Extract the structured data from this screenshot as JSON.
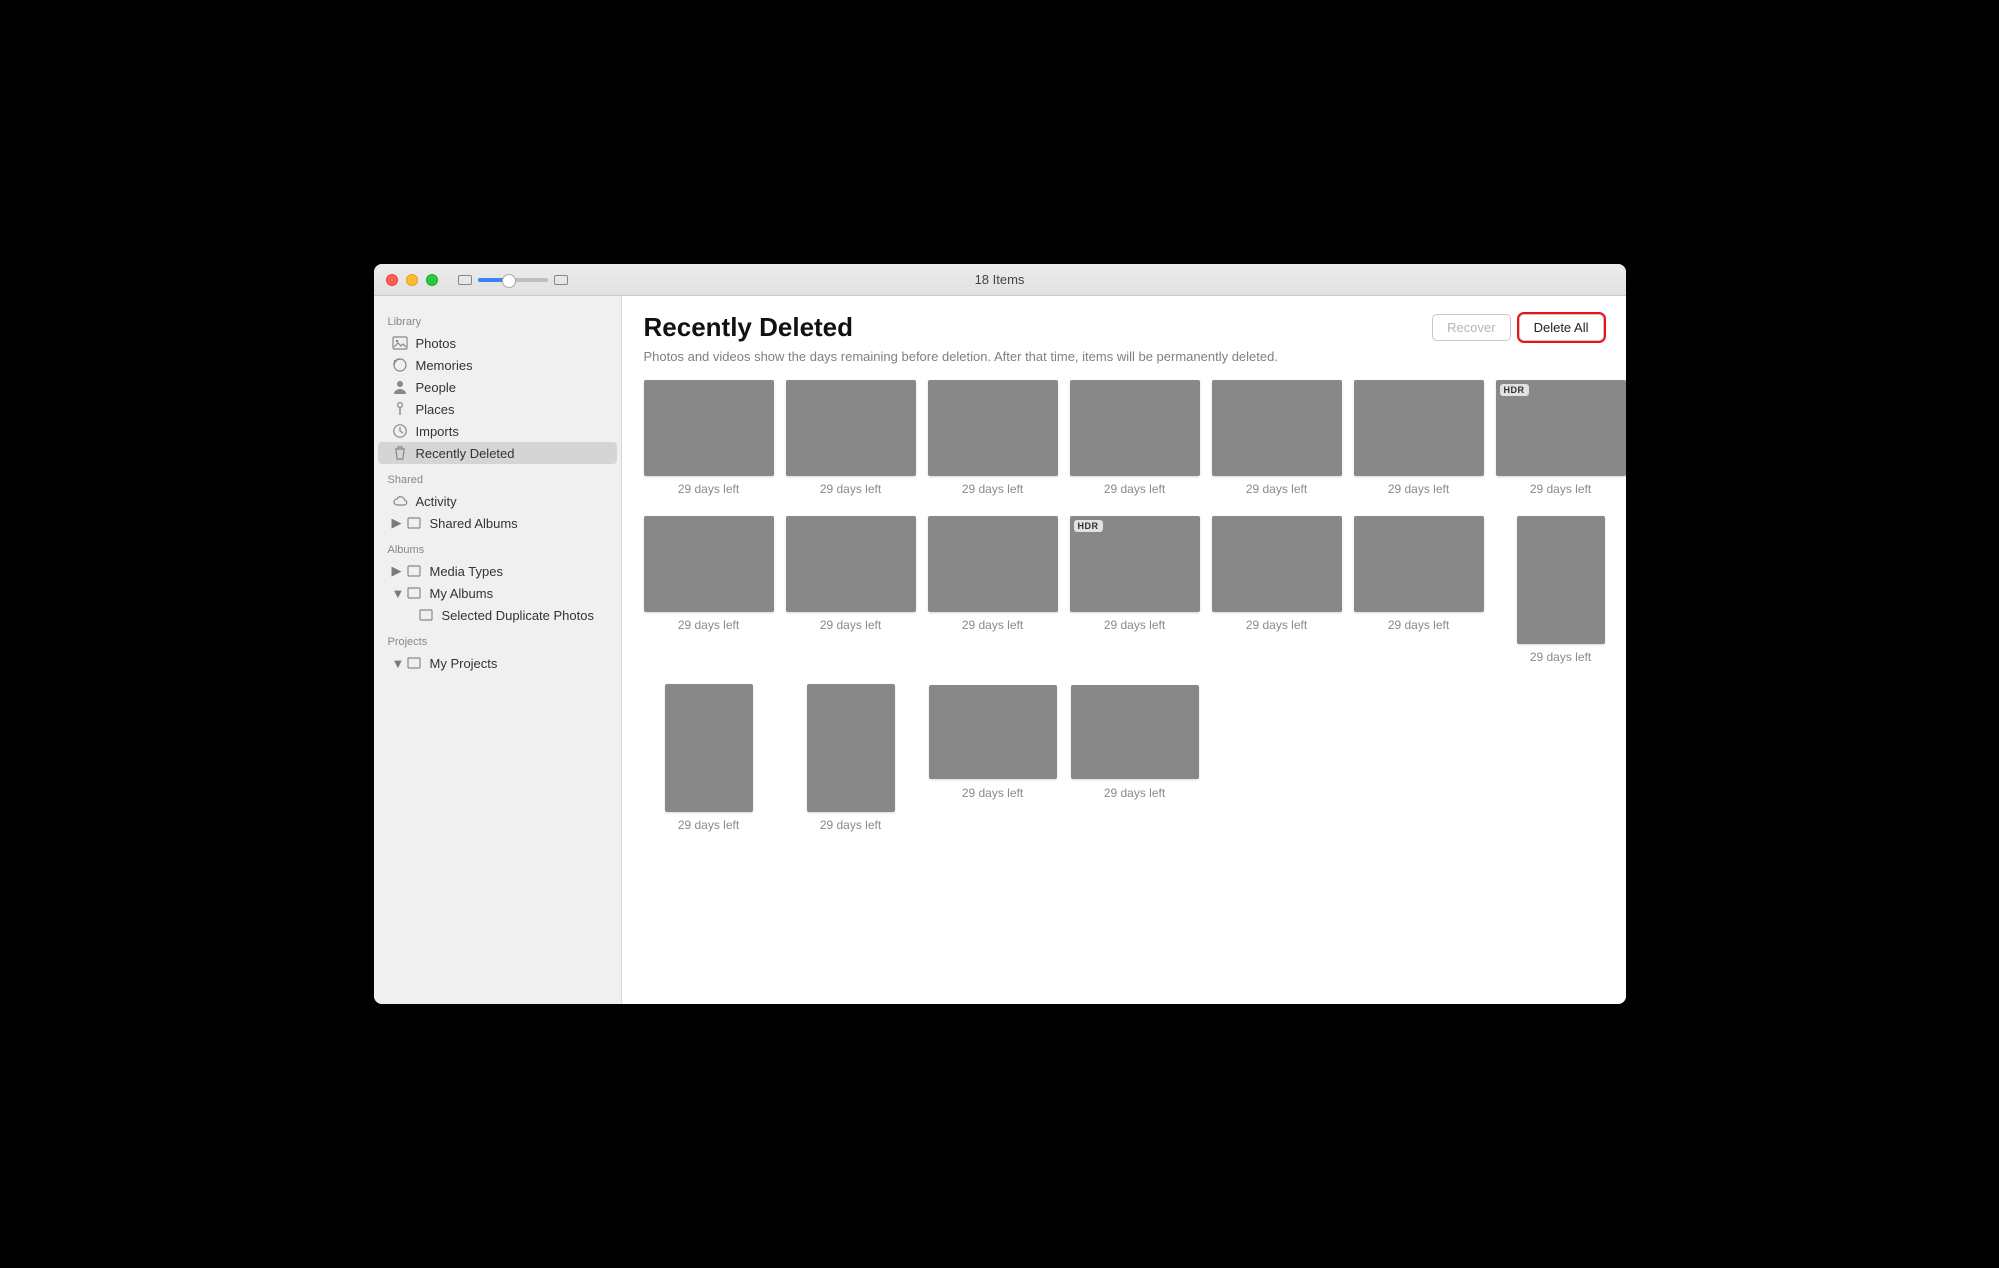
{
  "window": {
    "title": "18 Items"
  },
  "sidebar": {
    "sections": {
      "library": "Library",
      "shared": "Shared",
      "albums": "Albums",
      "projects": "Projects"
    },
    "library": {
      "photos": "Photos",
      "memories": "Memories",
      "people": "People",
      "places": "Places",
      "imports": "Imports",
      "recently_deleted": "Recently Deleted"
    },
    "shared": {
      "activity": "Activity",
      "shared_albums": "Shared Albums"
    },
    "albums": {
      "media_types": "Media Types",
      "my_albums": "My Albums",
      "selected_dup": "Selected Duplicate Photos"
    },
    "projects": {
      "my_projects": "My Projects"
    }
  },
  "header": {
    "title": "Recently Deleted",
    "subtitle": "Photos and videos show the days remaining before deletion. After that time, items will be permanently deleted.",
    "recover": "Recover",
    "delete_all": "Delete All"
  },
  "badge_hdr": "HDR",
  "items": [
    {
      "days": "29 days left",
      "shape": "land",
      "cls": "t-rock",
      "hdr": false
    },
    {
      "days": "29 days left",
      "shape": "land",
      "cls": "t-rock",
      "hdr": false
    },
    {
      "days": "29 days left",
      "shape": "land",
      "cls": "t-rock",
      "hdr": false
    },
    {
      "days": "29 days left",
      "shape": "land",
      "cls": "t-rock",
      "hdr": false
    },
    {
      "days": "29 days left",
      "shape": "land",
      "cls": "t-sign",
      "hdr": false
    },
    {
      "days": "29 days left",
      "shape": "land",
      "cls": "t-tree",
      "hdr": false
    },
    {
      "days": "29 days left",
      "shape": "land",
      "cls": "t-tree",
      "hdr": true
    },
    {
      "days": "29 days left",
      "shape": "land",
      "cls": "t-peacock",
      "hdr": false
    },
    {
      "days": "29 days left",
      "shape": "land",
      "cls": "t-beach",
      "hdr": false
    },
    {
      "days": "29 days left",
      "shape": "land",
      "cls": "t-beach",
      "hdr": false
    },
    {
      "days": "29 days left",
      "shape": "land",
      "cls": "t-beach",
      "hdr": true
    },
    {
      "days": "29 days left",
      "shape": "land",
      "cls": "t-beach",
      "hdr": false
    },
    {
      "days": "29 days left",
      "shape": "land",
      "cls": "t-beach",
      "hdr": false
    },
    {
      "days": "29 days left",
      "shape": "port",
      "cls": "t-boat",
      "hdr": false
    },
    {
      "days": "29 days left",
      "shape": "port",
      "cls": "t-stairs",
      "hdr": false
    },
    {
      "days": "29 days left",
      "shape": "port",
      "cls": "t-aquarium",
      "hdr": false
    },
    {
      "days": "29 days left",
      "shape": "land-s",
      "cls": "t-swan",
      "hdr": false
    },
    {
      "days": "29 days left",
      "shape": "land-s",
      "cls": "t-sky",
      "hdr": false
    }
  ]
}
